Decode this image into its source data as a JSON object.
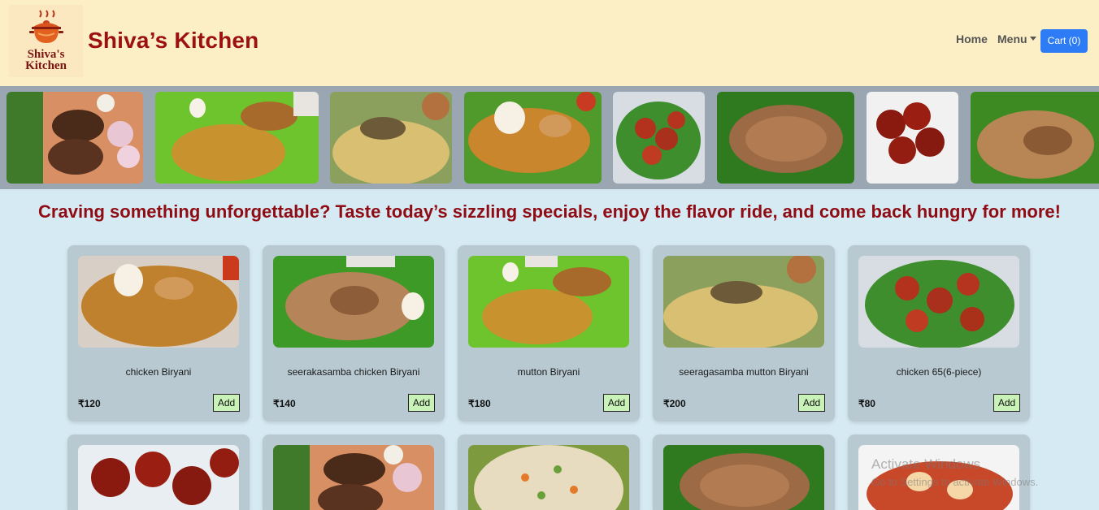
{
  "header": {
    "logo_line1": "Shiva's",
    "logo_line2": "Kitchen",
    "brand": "Shiva’s Kitchen",
    "nav_home": "Home",
    "nav_menu": "Menu",
    "cart_label": "Cart (0)"
  },
  "tagline": "Craving something unforgettable? Taste today’s sizzling specials, enjoy the flavor ride, and come back hungry for more!",
  "products": [
    {
      "name": "chicken Biryani",
      "price": "₹120",
      "add_label": "Add"
    },
    {
      "name": "seerakasamba chicken Biryani",
      "price": "₹140",
      "add_label": "Add"
    },
    {
      "name": "mutton Biryani",
      "price": "₹180",
      "add_label": "Add"
    },
    {
      "name": "seeragasamba mutton Biryani",
      "price": "₹200",
      "add_label": "Add"
    },
    {
      "name": "chicken 65(6-piece)",
      "price": "₹80",
      "add_label": "Add"
    }
  ],
  "watermark": {
    "line1": "Activate Windows",
    "line2": "Go to Settings to activate Windows."
  },
  "colors": {
    "header_bg": "#fcefc5",
    "page_bg": "#d6eaf3",
    "brand": "#9c1012",
    "cart_button": "#2d7cf6",
    "add_button": "#c9f2b8",
    "card_bg": "#b8c9d2"
  }
}
